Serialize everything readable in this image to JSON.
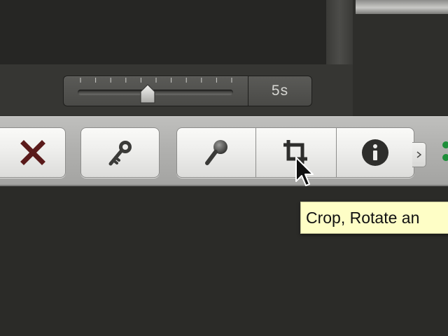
{
  "slider": {
    "duration_label": "5s",
    "position_fraction": 0.45,
    "tick_count": 11
  },
  "toolbar": {
    "buttons": [
      {
        "id": "reject",
        "icon": "x-icon",
        "color": "#5a1a1a"
      },
      {
        "id": "keywords",
        "icon": "key-icon"
      },
      {
        "id": "voiceover",
        "icon": "microphone-icon"
      },
      {
        "id": "crop",
        "icon": "crop-icon"
      },
      {
        "id": "info",
        "icon": "info-icon"
      }
    ]
  },
  "tooltip": {
    "text": "Crop, Rotate an"
  },
  "colors": {
    "background": "#2b2b28",
    "toolbar": "#b1b1af",
    "tooltip_bg": "#fefec6",
    "reject_icon": "#5a1a1a",
    "status_dot": "#1e8f3a"
  }
}
